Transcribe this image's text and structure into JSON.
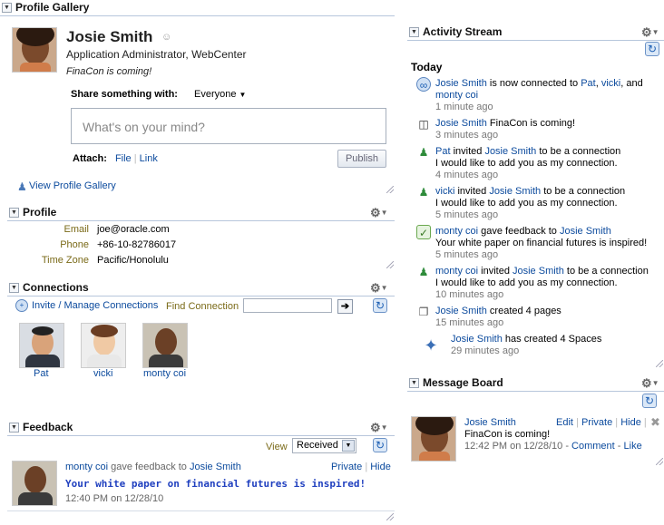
{
  "profile_gallery": {
    "header": "Profile Gallery",
    "name": "Josie Smith",
    "title": "Application Administrator, WebCenter",
    "status": "FinaCon is coming!",
    "share_label": "Share something with:",
    "share_target": "Everyone",
    "textarea_placeholder": "What's on your mind?",
    "attach_label": "Attach:",
    "attach_file": "File",
    "attach_link": "Link",
    "publish": "Publish",
    "view_gallery": "View Profile Gallery"
  },
  "profile": {
    "header": "Profile",
    "rows": [
      {
        "label": "Email",
        "value": "joe@oracle.com"
      },
      {
        "label": "Phone",
        "value": "+86-10-82786017"
      },
      {
        "label": "Time Zone",
        "value": "Pacific/Honolulu"
      }
    ]
  },
  "connections": {
    "header": "Connections",
    "invite": "Invite / Manage Connections",
    "find_label": "Find Connection",
    "people": [
      "Pat",
      "vicki",
      "monty coi"
    ]
  },
  "feedback": {
    "header": "Feedback",
    "view_label": "View",
    "view_value": "Received",
    "from": "monty coi",
    "gave_text": "gave feedback to",
    "to": "Josie Smith",
    "private": "Private",
    "hide": "Hide",
    "message": "Your white paper on financial futures is inspired!",
    "time": "12:40 PM on 12/28/10"
  },
  "activity": {
    "header": "Activity Stream",
    "today": "Today",
    "items": [
      {
        "l1a": "Josie Smith",
        "l1b": " is now connected to ",
        "l1c": "Pat",
        "l1d": ", ",
        "l1e": "vicki",
        "l1f": ", and",
        "l2": "monty coi",
        "time": "1 minute ago"
      },
      {
        "l1a": "Josie Smith",
        "l1b": " FinaCon is coming!",
        "time": "3 minutes ago"
      },
      {
        "l1a": "Pat",
        "l1b": " invited ",
        "l1c": "Josie Smith",
        "l1d": " to be a connection",
        "l2": "I would like to add you as my connection.",
        "time": "4 minutes ago"
      },
      {
        "l1a": "vicki",
        "l1b": " invited ",
        "l1c": "Josie Smith",
        "l1d": " to be a connection",
        "l2": "I would like to add you as my connection.",
        "time": "5 minutes ago"
      },
      {
        "l1a": "monty coi",
        "l1b": " gave feedback to ",
        "l1c": "Josie Smith",
        "l2": "Your white paper on financial futures is inspired!",
        "time": "5 minutes ago"
      },
      {
        "l1a": "monty coi",
        "l1b": " invited ",
        "l1c": "Josie Smith",
        "l1d": " to be a connection",
        "l2": "I would like to add you as my connection.",
        "time": "10 minutes ago"
      },
      {
        "l1a": "Josie Smith",
        "l1b": " created 4 pages",
        "time": "15 minutes ago"
      },
      {
        "l1a": "Josie Smith",
        "l1b": " has created 4 Spaces",
        "time": "29 minutes ago"
      }
    ]
  },
  "message_board": {
    "header": "Message Board",
    "author": "Josie Smith",
    "edit": "Edit",
    "private": "Private",
    "hide": "Hide",
    "message": "FinaCon is coming!",
    "time": "12:42 PM on 12/28/10",
    "comment": "Comment",
    "like": "Like"
  }
}
